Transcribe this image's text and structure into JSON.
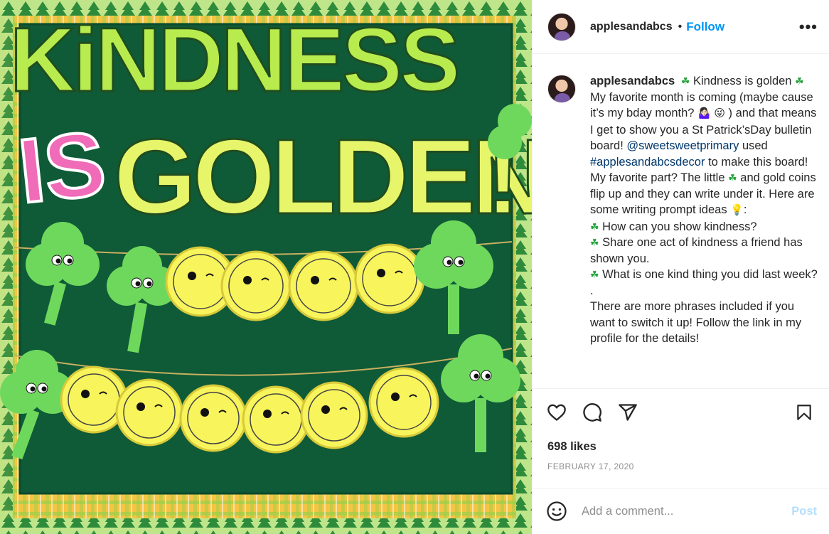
{
  "post": {
    "image": {
      "title_line1": "KiNDNESS",
      "title_is": "IS",
      "title_line2": "GOLDEN",
      "title_exclaim": "!",
      "colors": {
        "board_green": "#0f5a37",
        "border_yellow": "#f4c542",
        "title_green": "#b8ec4e",
        "is_pink": "#f06bb8",
        "golden_yellow": "#e6f56a",
        "clover_green": "#6ed85c",
        "coin_yellow": "#f8f45c"
      }
    },
    "author": {
      "username": "applesandabcs",
      "follow_label": "Follow",
      "separator": "•",
      "more_icon": "more-horizontal-icon"
    },
    "caption": {
      "username": "applesandabcs",
      "line_intro": "Kindness is golden",
      "text1": "My favorite month is coming (maybe cause it’s my bday month?",
      "emoji1": "🤷🏻‍♀️",
      "emoji2": "😜",
      "text2": ") and that means I get to show you a St Patrick’sDay bulletin board!",
      "mention": "@sweetsweetprimary",
      "text3": "used",
      "hashtag": "#applesandabcsdecor",
      "text4": "to make this board! My favorite part? The little",
      "text5": "and gold coins flip up and they can write under it. Here are some writing prompt ideas",
      "emoji_bulb": "💡",
      "text6": ":",
      "prompt1": "How can you show kindness?",
      "prompt2": "Share one act of kindness a friend has shown you.",
      "prompt3": "What is one kind thing you did last week?",
      "dot": ".",
      "text7": "There are more phrases included if you want to switch it up! Follow the link in my profile for the details!",
      "clover_glyph": "☘"
    },
    "actions": {
      "like_icon": "heart-icon",
      "comment_icon": "comment-icon",
      "share_icon": "paper-plane-icon",
      "save_icon": "bookmark-icon"
    },
    "likes": "698 likes",
    "date": "FEBRUARY 17, 2020",
    "comment_box": {
      "placeholder": "Add a comment...",
      "post_label": "Post",
      "emoji_icon": "smiley-icon"
    }
  }
}
